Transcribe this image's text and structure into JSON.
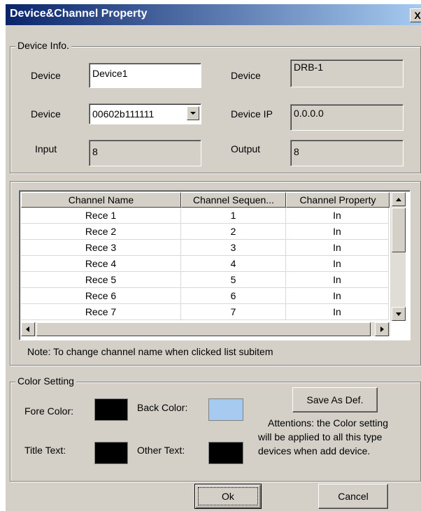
{
  "window": {
    "title": "Device&Channel Property",
    "close_glyph": "X"
  },
  "device_info": {
    "legend": "Device Info.",
    "device_name_label": "Device",
    "device_name_value": "Device1",
    "device_type_label": "Device",
    "device_type_value": "DRB-1",
    "device_id_label": "Device",
    "device_id_value": "00602b111111",
    "device_ip_label": "Device IP",
    "device_ip_value": "0.0.0.0",
    "input_label": "Input",
    "input_value": "8",
    "output_label": "Output",
    "output_value": "8"
  },
  "channel_list": {
    "columns": [
      "Channel Name",
      "Channel Sequen...",
      "Channel Property"
    ],
    "rows": [
      [
        "Rece 1",
        "1",
        "In"
      ],
      [
        "Rece 2",
        "2",
        "In"
      ],
      [
        "Rece 3",
        "3",
        "In"
      ],
      [
        "Rece 4",
        "4",
        "In"
      ],
      [
        "Rece 5",
        "5",
        "In"
      ],
      [
        "Rece 6",
        "6",
        "In"
      ],
      [
        "Rece 7",
        "7",
        "In"
      ]
    ],
    "note": "Note: To change channel name when clicked list subitem"
  },
  "color_setting": {
    "legend": "Color Setting",
    "fore_color_label": "Fore Color:",
    "back_color_label": "Back Color:",
    "title_text_label": "Title Text:",
    "other_text_label": "Other Text:",
    "save_button": "Save As Def.",
    "attention_line1": "Attentions: the Color setting",
    "attention_line2": "will be applied to all this type",
    "attention_line3": "devices when add device.",
    "colors": {
      "fore": "#000000",
      "back": "#a6caf0",
      "title_text": "#000000",
      "other_text": "#000000"
    }
  },
  "buttons": {
    "ok": "Ok",
    "cancel": "Cancel"
  }
}
